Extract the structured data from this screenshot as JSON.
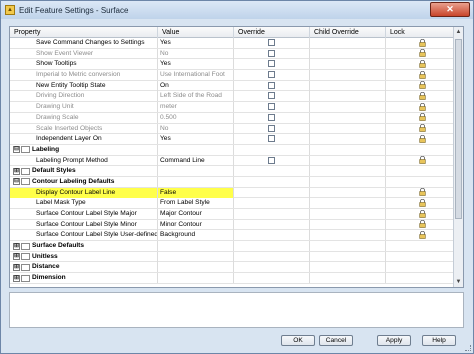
{
  "window": {
    "title": "Edit Feature Settings - Surface",
    "close_glyph": "✕",
    "app_icon": "app-icon"
  },
  "columns": [
    "Property",
    "Value",
    "Override",
    "Child Override",
    "Lock"
  ],
  "rows": [
    {
      "type": "item",
      "label": "Save Command Changes to Settings",
      "value": "Yes",
      "override": true,
      "lock": true
    },
    {
      "type": "item",
      "label": "Show Event Viewer",
      "value": "No",
      "dim": true,
      "override": true,
      "lock": true
    },
    {
      "type": "item",
      "label": "Show Tooltips",
      "value": "Yes",
      "override": true,
      "lock": true
    },
    {
      "type": "item",
      "label": "Imperial to Metric conversion",
      "value": "Use International Foot",
      "dim": true,
      "override": true,
      "lock": true
    },
    {
      "type": "item",
      "label": "New Entity Tooltip State",
      "value": "On",
      "override": true,
      "lock": true
    },
    {
      "type": "item",
      "label": "Driving Direction",
      "value": "Left Side of the Road",
      "dim": true,
      "override": true,
      "lock": true
    },
    {
      "type": "item",
      "label": "Drawing Unit",
      "value": "meter",
      "dim": true,
      "override": true,
      "lock": true
    },
    {
      "type": "item",
      "label": "Drawing Scale",
      "value": "0.500",
      "dim": true,
      "override": true,
      "lock": true
    },
    {
      "type": "item",
      "label": "Scale Inserted Objects",
      "value": "No",
      "dim": true,
      "override": true,
      "lock": true
    },
    {
      "type": "item",
      "label": "Independent Layer On",
      "value": "Yes",
      "override": true,
      "lock": true
    },
    {
      "type": "group",
      "label": "Labeling",
      "expander": "⊟"
    },
    {
      "type": "item",
      "label": "Labeling Prompt Method",
      "value": "Command Line",
      "override": true,
      "lock": true
    },
    {
      "type": "group",
      "label": "Default Styles",
      "expander": "⊞"
    },
    {
      "type": "group",
      "label": "Contour Labeling Defaults",
      "expander": "⊟"
    },
    {
      "type": "item",
      "label": "Display Contour Label Line",
      "value": "False",
      "highlight": true,
      "override": false,
      "lock": true
    },
    {
      "type": "item",
      "label": "Label Mask Type",
      "value": "From Label Style",
      "override": false,
      "lock": true
    },
    {
      "type": "item",
      "label": "Surface Contour Label Style Major",
      "value": "Major Contour",
      "override": false,
      "lock": true
    },
    {
      "type": "item",
      "label": "Surface Contour Label Style Minor",
      "value": "Minor Contour",
      "override": false,
      "lock": true
    },
    {
      "type": "item",
      "label": "Surface Contour Label Style User-defined",
      "value": "Background",
      "override": false,
      "lock": true
    },
    {
      "type": "group",
      "label": "Surface Defaults",
      "expander": "⊞"
    },
    {
      "type": "group",
      "label": "Unitless",
      "expander": "⊞"
    },
    {
      "type": "group",
      "label": "Distance",
      "expander": "⊞"
    },
    {
      "type": "group",
      "label": "Dimension",
      "expander": "⊞"
    }
  ],
  "buttons": {
    "ok": "OK",
    "cancel": "Cancel",
    "apply": "Apply",
    "help": "Help"
  },
  "colors": {
    "highlight": "#ffff4a",
    "title_bar": "#bfd3ea",
    "close": "#c8442a"
  }
}
